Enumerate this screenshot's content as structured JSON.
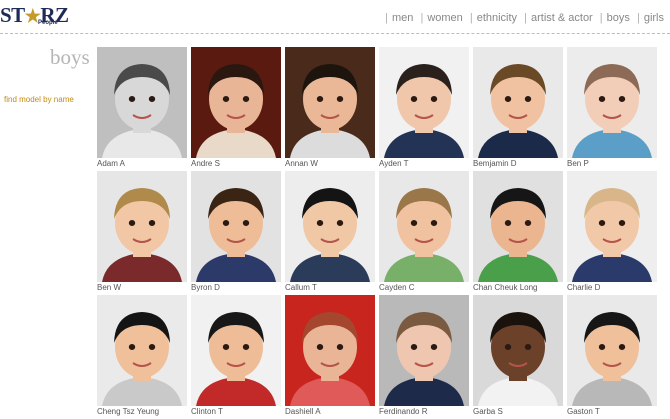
{
  "brand": {
    "logo_text_left": "ST",
    "logo_text_right": "RZ",
    "logo_sub": "People"
  },
  "nav": {
    "items": [
      "men",
      "women",
      "ethnicity",
      "artist & actor",
      "boys",
      "girls"
    ]
  },
  "page": {
    "title": "boys",
    "find_link": "find model by name"
  },
  "models": [
    {
      "name": "Adam A",
      "bg": "#bfbfbf",
      "skin": "#d8d8d8",
      "hair": "#4a4a4a",
      "shirt": "#e8e8e8"
    },
    {
      "name": "Andre S",
      "bg": "#5a1a10",
      "skin": "#e9b597",
      "hair": "#2a1810",
      "shirt": "#e8d9c8"
    },
    {
      "name": "Annan W",
      "bg": "#4a2a1a",
      "skin": "#eab896",
      "hair": "#1e140e",
      "shirt": "#dcdcdc"
    },
    {
      "name": "Ayden T",
      "bg": "#f1f1f1",
      "skin": "#f0c7ab",
      "hair": "#2b211c",
      "shirt": "#223355"
    },
    {
      "name": "Bemjamin D",
      "bg": "#e9e9e9",
      "skin": "#f0c2a1",
      "hair": "#6a4a26",
      "shirt": "#1c2a4a"
    },
    {
      "name": "Ben P",
      "bg": "#ececec",
      "skin": "#f2cdb8",
      "hair": "#8c6a55",
      "shirt": "#5b9ec8"
    },
    {
      "name": "Ben W",
      "bg": "#e6e6e6",
      "skin": "#f1c7a6",
      "hair": "#b08a4a",
      "shirt": "#7a2a2a"
    },
    {
      "name": "Byron D",
      "bg": "#e2e2e2",
      "skin": "#eebd98",
      "hair": "#3a2414",
      "shirt": "#2c3a6a"
    },
    {
      "name": "Callum T",
      "bg": "#ededed",
      "skin": "#f1c8a6",
      "hair": "#141414",
      "shirt": "#2b3c5a"
    },
    {
      "name": "Cayden C",
      "bg": "#e8e8e8",
      "skin": "#f1c2a0",
      "hair": "#9a7748",
      "shirt": "#78b06a"
    },
    {
      "name": "Chan Cheuk Long",
      "bg": "#e0e0e0",
      "skin": "#eab58f",
      "hair": "#161616",
      "shirt": "#4aa04a"
    },
    {
      "name": "Charlie D",
      "bg": "#eeeeee",
      "skin": "#f2c9a8",
      "hair": "#d8b68a",
      "shirt": "#2a3a6a"
    },
    {
      "name": "Cheng Tsz Yeung",
      "bg": "#eaeaea",
      "skin": "#efc09a",
      "hair": "#141414",
      "shirt": "#c9c9c9"
    },
    {
      "name": "Clinton T",
      "bg": "#f1f1f1",
      "skin": "#efbc98",
      "hair": "#181818",
      "shirt": "#c22a2a"
    },
    {
      "name": "Dashiell A",
      "bg": "#c8251e",
      "skin": "#eab497",
      "hair": "#a5472e",
      "shirt": "#e05a5a"
    },
    {
      "name": "Ferdinando R",
      "bg": "#b9b9b9",
      "skin": "#efc7b0",
      "hair": "#7a5a40",
      "shirt": "#1e2a4a"
    },
    {
      "name": "Garba S",
      "bg": "#d9d9d9",
      "skin": "#6b4129",
      "hair": "#1a120c",
      "shirt": "#f2f2f2"
    },
    {
      "name": "Gaston T",
      "bg": "#e9e9e9",
      "skin": "#f0c09b",
      "hair": "#161616",
      "shirt": "#b8b8b8"
    }
  ]
}
